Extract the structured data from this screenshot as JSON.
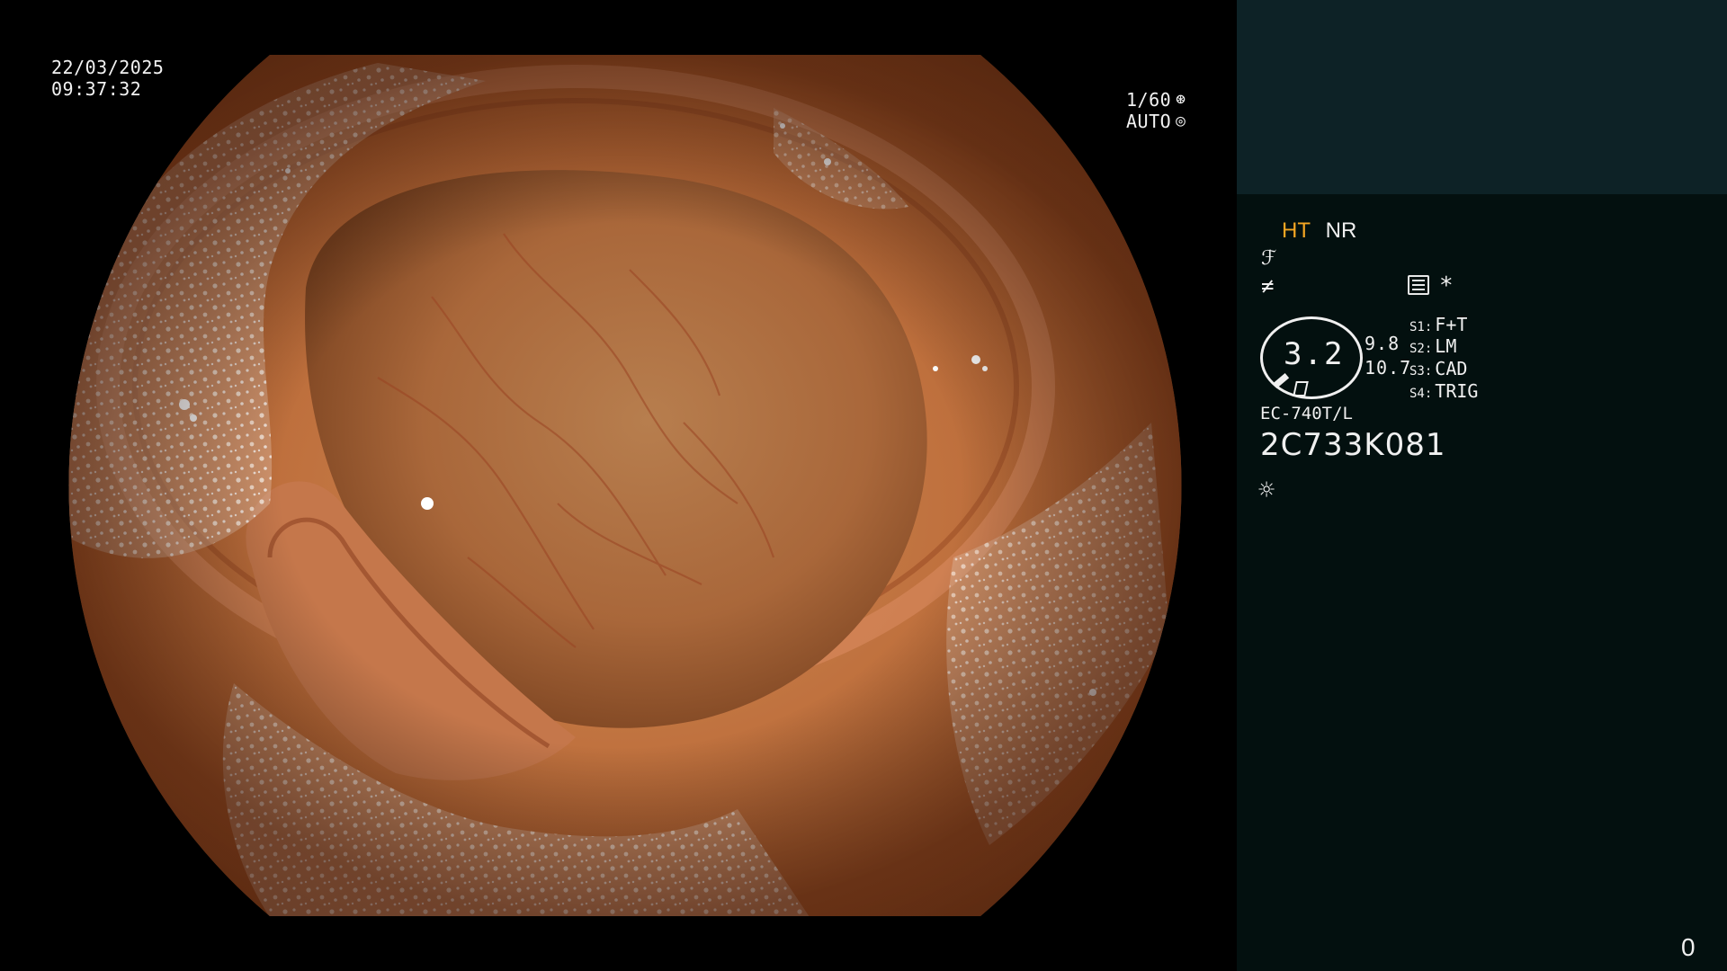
{
  "overlay": {
    "date": "22/03/2025",
    "time": "09:37:32",
    "shutter": "1/60",
    "shutter_icon": "aperture-icon",
    "exposure": "AUTO",
    "exposure_icon": "iris-icon"
  },
  "panel": {
    "mode_ht": "HT",
    "mode_nr": "NR",
    "zoom_value": "3.2",
    "value_upper": "9.8",
    "value_lower": "10.7",
    "switches": [
      {
        "key": "S1:",
        "value": "F+T"
      },
      {
        "key": "S2:",
        "value": "LM"
      },
      {
        "key": "S3:",
        "value": "CAD"
      },
      {
        "key": "S4:",
        "value": "TRIG"
      }
    ],
    "scope_model": "EC-740T/L",
    "scope_serial": "2C733K081",
    "frame_counter": "0",
    "colors": {
      "ht_accent": "#f5a623",
      "panel_top": "#0d2226",
      "panel_bg": "#03100f"
    }
  }
}
